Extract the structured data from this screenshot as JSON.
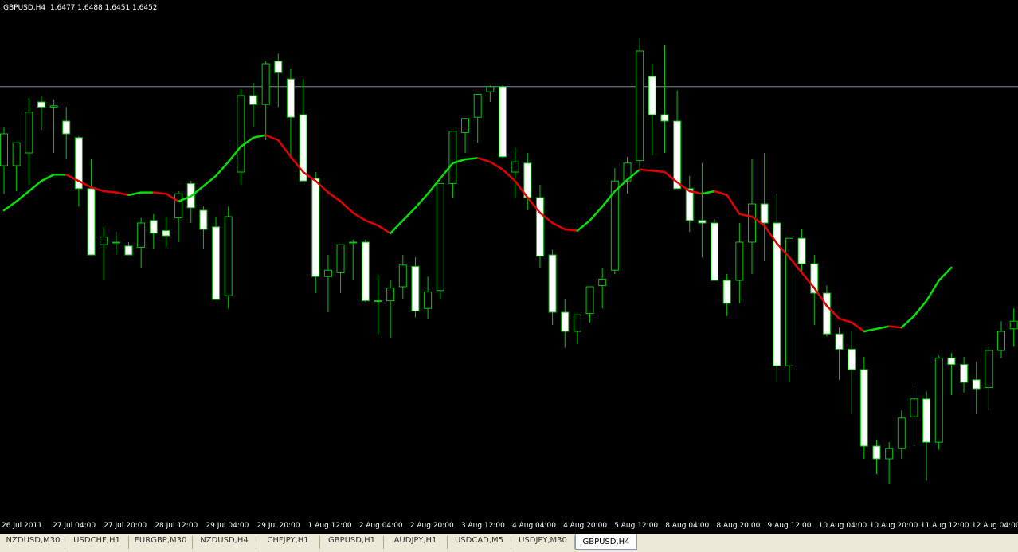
{
  "header": {
    "symbol": "GBPUSD,H4",
    "open": "1.6477",
    "high": "1.6488",
    "low": "1.6451",
    "close": "1.6452"
  },
  "colors": {
    "background": "#000000",
    "bull_fill": "#000000",
    "bear_fill": "#ffffff",
    "wick": "#00c800",
    "ma_up": "#00e000",
    "ma_down": "#e00000",
    "price_line": "#7f8c99"
  },
  "tabs": [
    {
      "label": "NZDUSD,M30",
      "active": false
    },
    {
      "label": "USDCHF,H1",
      "active": false
    },
    {
      "label": "EURGBP,M30",
      "active": false
    },
    {
      "label": "NZDUSD,H4",
      "active": false
    },
    {
      "label": "CHFJPY,H1",
      "active": false
    },
    {
      "label": "GBPUSD,H1",
      "active": false
    },
    {
      "label": "AUDJPY,H1",
      "active": false
    },
    {
      "label": "USDCAD,M5",
      "active": false
    },
    {
      "label": "USDJPY,M30",
      "active": false
    },
    {
      "label": "GBPUSD,H4",
      "active": true
    }
  ],
  "chart_data": {
    "type": "candlestick",
    "title": "GBPUSD,H4",
    "price_line": 1.6452,
    "x_ticks": [
      "26 Jul 2011",
      "27 Jul 04:00",
      "27 Jul 20:00",
      "28 Jul 12:00",
      "29 Jul 04:00",
      "29 Jul 20:00",
      "1 Aug 12:00",
      "2 Aug 04:00",
      "2 Aug 20:00",
      "3 Aug 12:00",
      "4 Aug 04:00",
      "4 Aug 20:00",
      "5 Aug 12:00",
      "8 Aug 04:00",
      "8 Aug 20:00",
      "9 Aug 12:00",
      "10 Aug 04:00",
      "10 Aug 20:00",
      "11 Aug 12:00",
      "12 Aug 04:00"
    ],
    "candles": [
      {
        "o": 1.639,
        "h": 1.642,
        "l": 1.6368,
        "c": 1.6415
      },
      {
        "o": 1.639,
        "h": 1.6405,
        "l": 1.637,
        "c": 1.6408
      },
      {
        "o": 1.64,
        "h": 1.6443,
        "l": 1.6375,
        "c": 1.6432
      },
      {
        "o": 1.644,
        "h": 1.6445,
        "l": 1.6418,
        "c": 1.6436
      },
      {
        "o": 1.6436,
        "h": 1.6442,
        "l": 1.64,
        "c": 1.6437
      },
      {
        "o": 1.6425,
        "h": 1.6436,
        "l": 1.6395,
        "c": 1.6415
      },
      {
        "o": 1.6412,
        "h": 1.6413,
        "l": 1.6358,
        "c": 1.6372
      },
      {
        "o": 1.6372,
        "h": 1.6395,
        "l": 1.6352,
        "c": 1.632
      },
      {
        "o": 1.6328,
        "h": 1.6342,
        "l": 1.63,
        "c": 1.6334
      },
      {
        "o": 1.633,
        "h": 1.6338,
        "l": 1.632,
        "c": 1.633
      },
      {
        "o": 1.6327,
        "h": 1.633,
        "l": 1.6322,
        "c": 1.632
      },
      {
        "o": 1.6326,
        "h": 1.6349,
        "l": 1.631,
        "c": 1.6345
      },
      {
        "o": 1.6347,
        "h": 1.6352,
        "l": 1.6325,
        "c": 1.6337
      },
      {
        "o": 1.6339,
        "h": 1.635,
        "l": 1.6326,
        "c": 1.6335
      },
      {
        "o": 1.6349,
        "h": 1.637,
        "l": 1.633,
        "c": 1.6368
      },
      {
        "o": 1.6376,
        "h": 1.6378,
        "l": 1.6345,
        "c": 1.6357
      },
      {
        "o": 1.6355,
        "h": 1.6358,
        "l": 1.6325,
        "c": 1.634
      },
      {
        "o": 1.6342,
        "h": 1.635,
        "l": 1.6302,
        "c": 1.6285
      },
      {
        "o": 1.6288,
        "h": 1.6358,
        "l": 1.6278,
        "c": 1.635
      },
      {
        "o": 1.6385,
        "h": 1.645,
        "l": 1.6375,
        "c": 1.6445
      },
      {
        "o": 1.6445,
        "h": 1.6455,
        "l": 1.642,
        "c": 1.6438
      },
      {
        "o": 1.6438,
        "h": 1.6472,
        "l": 1.641,
        "c": 1.647
      },
      {
        "o": 1.6472,
        "h": 1.6478,
        "l": 1.6436,
        "c": 1.6463
      },
      {
        "o": 1.6458,
        "h": 1.6466,
        "l": 1.6398,
        "c": 1.6428
      },
      {
        "o": 1.643,
        "h": 1.6458,
        "l": 1.6378,
        "c": 1.6378
      },
      {
        "o": 1.638,
        "h": 1.6385,
        "l": 1.629,
        "c": 1.6303
      },
      {
        "o": 1.6303,
        "h": 1.632,
        "l": 1.6275,
        "c": 1.6308
      },
      {
        "o": 1.6306,
        "h": 1.6325,
        "l": 1.629,
        "c": 1.6328
      },
      {
        "o": 1.633,
        "h": 1.6332,
        "l": 1.63,
        "c": 1.633
      },
      {
        "o": 1.633,
        "h": 1.6332,
        "l": 1.6283,
        "c": 1.6284
      },
      {
        "o": 1.6284,
        "h": 1.6304,
        "l": 1.6258,
        "c": 1.6284
      },
      {
        "o": 1.6284,
        "h": 1.63,
        "l": 1.6255,
        "c": 1.6294
      },
      {
        "o": 1.6295,
        "h": 1.632,
        "l": 1.6285,
        "c": 1.6312
      },
      {
        "o": 1.6311,
        "h": 1.6318,
        "l": 1.6271,
        "c": 1.6276
      },
      {
        "o": 1.6278,
        "h": 1.6303,
        "l": 1.627,
        "c": 1.6291
      },
      {
        "o": 1.6292,
        "h": 1.631,
        "l": 1.6285,
        "c": 1.6376
      },
      {
        "o": 1.6376,
        "h": 1.6404,
        "l": 1.6365,
        "c": 1.6417
      },
      {
        "o": 1.6416,
        "h": 1.642,
        "l": 1.64,
        "c": 1.6427
      },
      {
        "o": 1.6428,
        "h": 1.6446,
        "l": 1.6408,
        "c": 1.6446
      },
      {
        "o": 1.6448,
        "h": 1.6453,
        "l": 1.644,
        "c": 1.6452
      },
      {
        "o": 1.6452,
        "h": 1.6453,
        "l": 1.6396,
        "c": 1.6397
      },
      {
        "o": 1.6385,
        "h": 1.6404,
        "l": 1.6365,
        "c": 1.6393
      },
      {
        "o": 1.6392,
        "h": 1.64,
        "l": 1.6355,
        "c": 1.6365
      },
      {
        "o": 1.6365,
        "h": 1.6375,
        "l": 1.631,
        "c": 1.6319
      },
      {
        "o": 1.632,
        "h": 1.6324,
        "l": 1.6265,
        "c": 1.6275
      },
      {
        "o": 1.6275,
        "h": 1.6285,
        "l": 1.6247,
        "c": 1.626
      },
      {
        "o": 1.626,
        "h": 1.6268,
        "l": 1.625,
        "c": 1.6273
      },
      {
        "o": 1.6274,
        "h": 1.6293,
        "l": 1.6267,
        "c": 1.6295
      },
      {
        "o": 1.6296,
        "h": 1.631,
        "l": 1.6278,
        "c": 1.6301
      },
      {
        "o": 1.6308,
        "h": 1.6388,
        "l": 1.6305,
        "c": 1.6378
      },
      {
        "o": 1.6378,
        "h": 1.6397,
        "l": 1.6368,
        "c": 1.6392
      },
      {
        "o": 1.6394,
        "h": 1.649,
        "l": 1.6388,
        "c": 1.648
      },
      {
        "o": 1.646,
        "h": 1.647,
        "l": 1.6398,
        "c": 1.643
      },
      {
        "o": 1.643,
        "h": 1.6485,
        "l": 1.64,
        "c": 1.6425
      },
      {
        "o": 1.6425,
        "h": 1.6449,
        "l": 1.6387,
        "c": 1.6372
      },
      {
        "o": 1.6372,
        "h": 1.6382,
        "l": 1.6338,
        "c": 1.6347
      },
      {
        "o": 1.6347,
        "h": 1.6392,
        "l": 1.6318,
        "c": 1.6345
      },
      {
        "o": 1.6345,
        "h": 1.6348,
        "l": 1.6303,
        "c": 1.63
      },
      {
        "o": 1.63,
        "h": 1.6305,
        "l": 1.6272,
        "c": 1.6282
      },
      {
        "o": 1.63,
        "h": 1.6345,
        "l": 1.6282,
        "c": 1.633
      },
      {
        "o": 1.633,
        "h": 1.6395,
        "l": 1.6305,
        "c": 1.636
      },
      {
        "o": 1.636,
        "h": 1.64,
        "l": 1.6315,
        "c": 1.6345
      },
      {
        "o": 1.6345,
        "h": 1.6368,
        "l": 1.622,
        "c": 1.6233
      },
      {
        "o": 1.6233,
        "h": 1.6315,
        "l": 1.622,
        "c": 1.6333
      },
      {
        "o": 1.6333,
        "h": 1.634,
        "l": 1.6305,
        "c": 1.6313
      },
      {
        "o": 1.6313,
        "h": 1.632,
        "l": 1.6265,
        "c": 1.629
      },
      {
        "o": 1.629,
        "h": 1.6296,
        "l": 1.6256,
        "c": 1.6258
      },
      {
        "o": 1.6258,
        "h": 1.6263,
        "l": 1.6222,
        "c": 1.6246
      },
      {
        "o": 1.6246,
        "h": 1.626,
        "l": 1.6195,
        "c": 1.623
      },
      {
        "o": 1.623,
        "h": 1.624,
        "l": 1.616,
        "c": 1.617
      },
      {
        "o": 1.617,
        "h": 1.6175,
        "l": 1.6148,
        "c": 1.616
      },
      {
        "o": 1.616,
        "h": 1.6173,
        "l": 1.614,
        "c": 1.6168
      },
      {
        "o": 1.6168,
        "h": 1.6198,
        "l": 1.616,
        "c": 1.6192
      },
      {
        "o": 1.6193,
        "h": 1.6217,
        "l": 1.6172,
        "c": 1.6207
      },
      {
        "o": 1.6207,
        "h": 1.6213,
        "l": 1.6143,
        "c": 1.6173
      },
      {
        "o": 1.6173,
        "h": 1.6241,
        "l": 1.6167,
        "c": 1.6239
      },
      {
        "o": 1.6239,
        "h": 1.6243,
        "l": 1.621,
        "c": 1.6234
      },
      {
        "o": 1.6234,
        "h": 1.624,
        "l": 1.6212,
        "c": 1.622
      },
      {
        "o": 1.6222,
        "h": 1.6236,
        "l": 1.6195,
        "c": 1.6215
      },
      {
        "o": 1.6216,
        "h": 1.6248,
        "l": 1.6198,
        "c": 1.6245
      },
      {
        "o": 1.6245,
        "h": 1.6268,
        "l": 1.6239,
        "c": 1.626
      },
      {
        "o": 1.6262,
        "h": 1.6278,
        "l": 1.6248,
        "c": 1.6268
      }
    ],
    "ma": [
      1.6355,
      1.6362,
      1.637,
      1.6378,
      1.6383,
      1.6383,
      1.6378,
      1.6373,
      1.637,
      1.6369,
      1.6367,
      1.6369,
      1.6369,
      1.6368,
      1.6362,
      1.6366,
      1.6374,
      1.6382,
      1.6393,
      1.6405,
      1.6412,
      1.6414,
      1.641,
      1.6397,
      1.6385,
      1.6378,
      1.6369,
      1.6362,
      1.6353,
      1.6347,
      1.6343,
      1.6337,
      1.6347,
      1.6357,
      1.6368,
      1.638,
      1.6392,
      1.6395,
      1.6396,
      1.6393,
      1.6387,
      1.6378,
      1.6365,
      1.6353,
      1.6345,
      1.634,
      1.6339,
      1.6347,
      1.6358,
      1.637,
      1.6379,
      1.6387,
      1.6386,
      1.6385,
      1.6377,
      1.637,
      1.6368,
      1.637,
      1.6367,
      1.6352,
      1.635,
      1.6343,
      1.6329,
      1.6318,
      1.6306,
      1.6294,
      1.628,
      1.627,
      1.6267,
      1.626,
      1.6262,
      1.6264,
      1.6263,
      1.6272,
      1.6284,
      1.63,
      1.631
    ],
    "x_range": [
      0,
      82
    ],
    "y_range": [
      1.612,
      1.651
    ]
  }
}
